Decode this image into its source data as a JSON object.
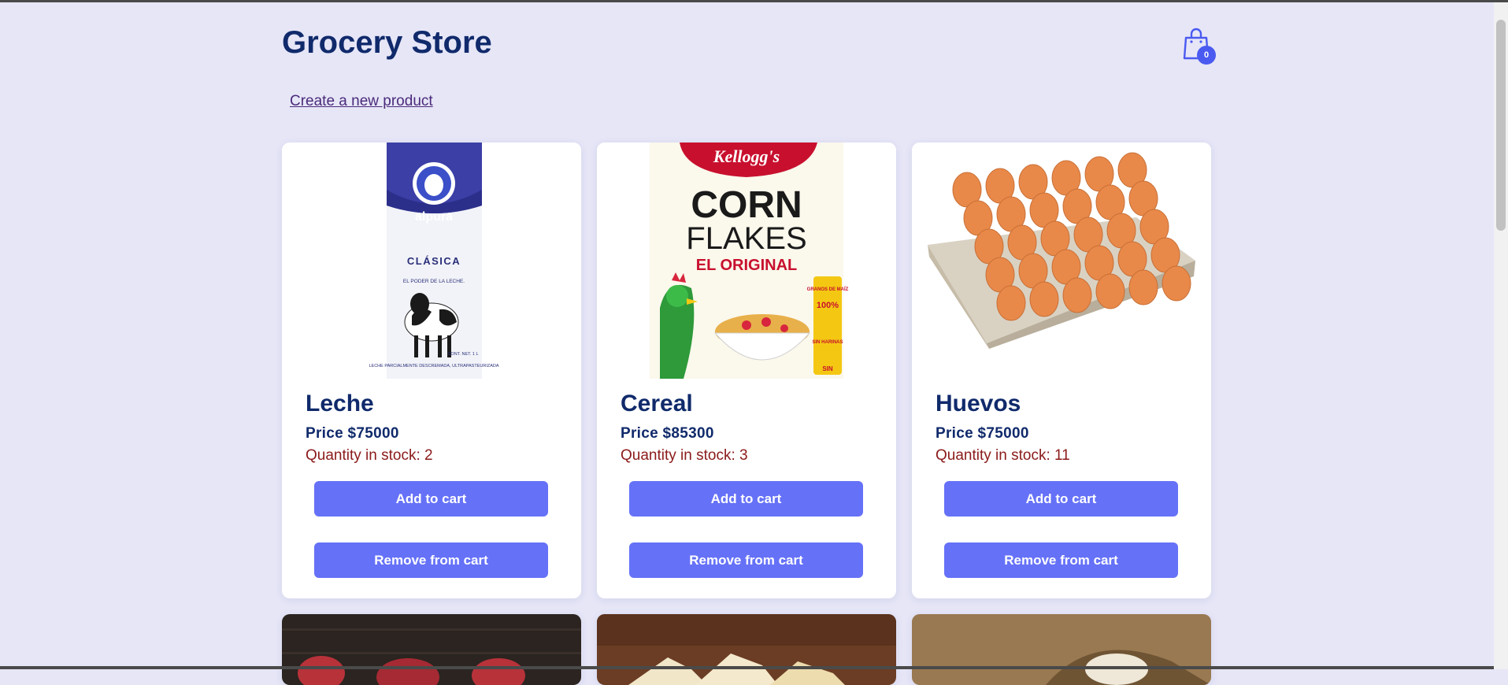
{
  "header": {
    "title": "Grocery Store",
    "cart_count": "0"
  },
  "create_link": "Create a new product",
  "products": [
    {
      "name": "Leche",
      "price": "Price $75000",
      "stock": "Quantity in stock: 2",
      "add_label": "Add to cart",
      "remove_label": "Remove from cart",
      "image_text": {
        "brand": "alpura",
        "variant": "CLÁSICA",
        "tagline": "EL PODER DE LA LECHE.",
        "net": "CONT. NET. 1 L",
        "desc": "LECHE PARCIALMENTE DESCREMADA, ULTRAPASTEURIZADA"
      }
    },
    {
      "name": "Cereal",
      "price": "Price $85300",
      "stock": "Quantity in stock: 3",
      "add_label": "Add to cart",
      "remove_label": "Remove from cart",
      "image_text": {
        "brand": "Kellogg's",
        "line1": "CORN",
        "line2": "FLAKES",
        "line3": "EL ORIGINAL",
        "side1": "GRANOS DE MAÍZ",
        "side2": "100%",
        "side3": "SIN HARINAS",
        "side4": "SIN"
      }
    },
    {
      "name": "Huevos",
      "price": "Price $75000",
      "stock": "Quantity in stock: 11",
      "add_label": "Add to cart",
      "remove_label": "Remove from cart"
    }
  ],
  "colors": {
    "background": "#e6e6f7",
    "heading": "#102a6b",
    "stock_text": "#8b1a1a",
    "button": "#6571f7",
    "cart_icon": "#4a5af0"
  }
}
